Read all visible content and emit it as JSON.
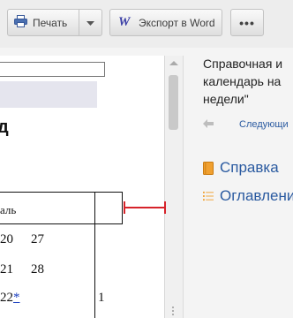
{
  "toolbar": {
    "print_label": "Печать",
    "export_label": "Экспорт в Word",
    "more_label": "•••"
  },
  "document": {
    "heading": "д",
    "table_header": "аль",
    "rows": [
      [
        "20",
        "27"
      ],
      [
        "21",
        "28"
      ]
    ],
    "link_cell_prefix": "22",
    "link_cell_star": "*",
    "right_cell": "1"
  },
  "side": {
    "note": "Справочная и\nкалендарь на\nнедели\"",
    "next_label": "Следующи",
    "help_label": "Справка",
    "toc_label": "Оглавлени"
  },
  "colors": {
    "accent_link": "#2a5aa0",
    "marker": "#d6232a",
    "word_icon": "#3b3fa6"
  }
}
